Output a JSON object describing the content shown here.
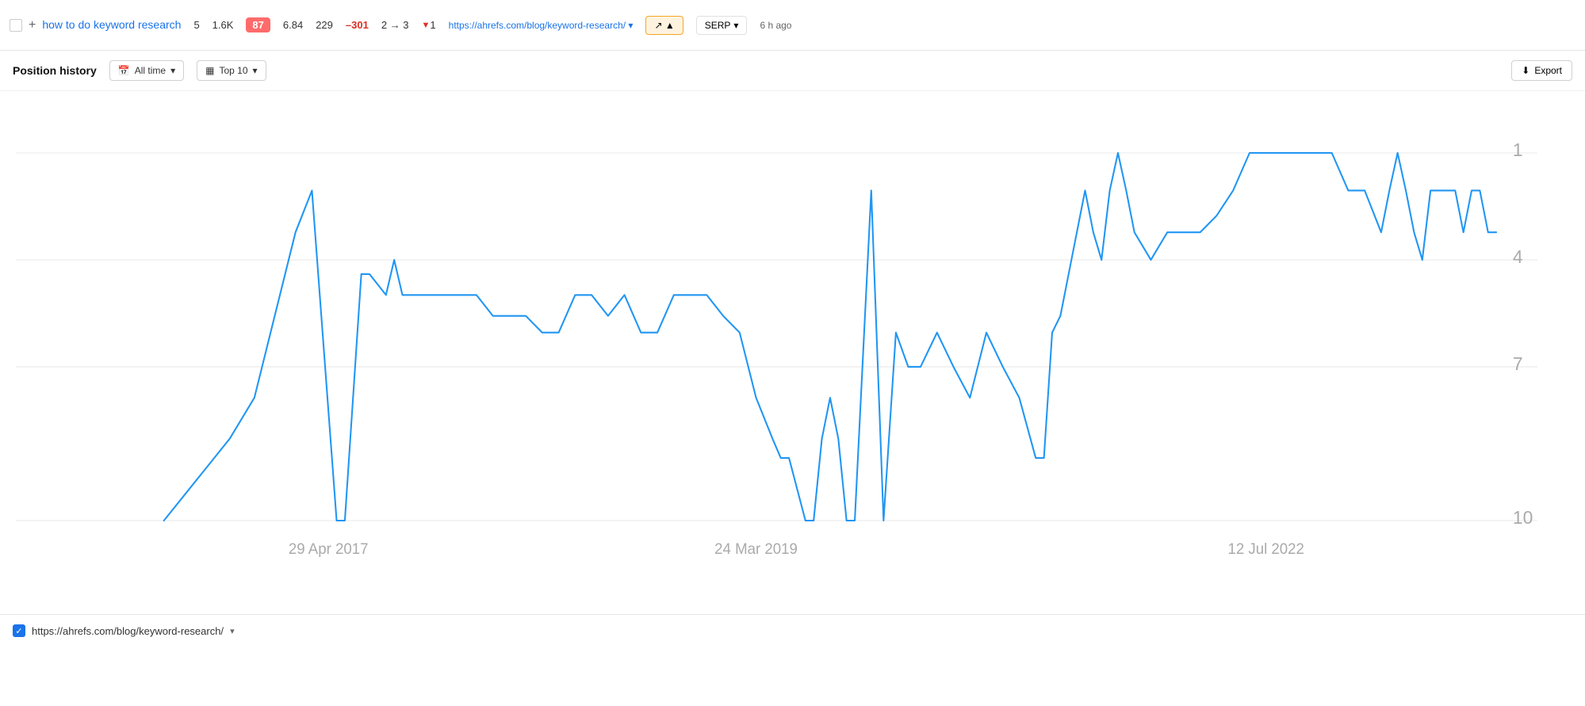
{
  "topRow": {
    "keyword": "how to do keyword research",
    "metricPosition": "5",
    "metricVolume": "1.6K",
    "metricKD": "87",
    "metricCPC": "6.84",
    "metricTraffic": "229",
    "metricChange": "–301",
    "metricPositionChange": "2 → 3",
    "metricDelta": "1",
    "url": "https://ahrefs.com/blog/keyword-research/",
    "urlShort": "https://ahrefs.com/blog/k eyword-research/",
    "chartBtnLabel": "↗ ▲",
    "serpLabel": "SERP",
    "timeAgo": "6 h ago"
  },
  "toolbar": {
    "title": "Position history",
    "allTimeLabel": "All time",
    "top10Label": "Top 10",
    "exportLabel": "Export"
  },
  "chart": {
    "yLabels": [
      "1",
      "4",
      "7",
      "10"
    ],
    "xLabels": [
      "29 Apr 2017",
      "24 Mar 2019",
      "12 Jul 2022"
    ]
  },
  "bottomRow": {
    "url": "https://ahrefs.com/blog/keyword-research/"
  },
  "icons": {
    "close": "×",
    "calendar": "📅",
    "table": "▦",
    "download": "⬇",
    "chevronDown": "▼",
    "chevronDownSmall": "▾"
  }
}
